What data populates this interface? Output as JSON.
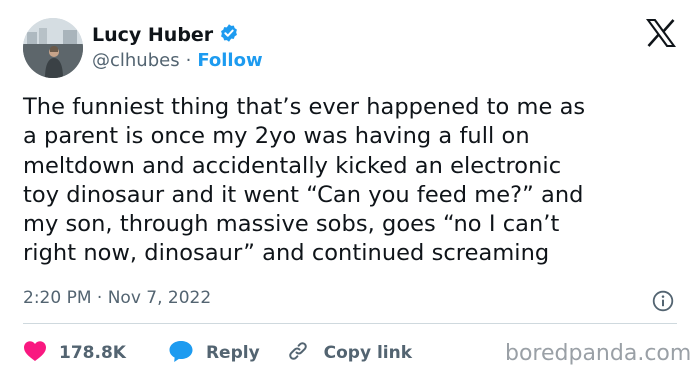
{
  "author": {
    "display_name": "Lucy Huber",
    "handle": "@clhubes",
    "separator": "·",
    "follow_label": "Follow",
    "verified_icon": "verified-badge-icon"
  },
  "platform_logo": "x-logo-icon",
  "tweet": {
    "lines": [
      "The funniest thing that’s ever happened to me as",
      "a parent is once my 2yo was having a full on",
      "meltdown and accidentally kicked an electronic",
      "toy dinosaur and it went “Can you feed me?” and",
      "my son, through massive sobs, goes “no I can’t",
      "right now, dinosaur” and continued screaming"
    ],
    "timestamp": "2:20 PM · Nov 7, 2022"
  },
  "actions": {
    "likes_count": "178.8K",
    "reply_label": "Reply",
    "copy_link_label": "Copy link"
  },
  "watermark": "boredpanda.com",
  "colors": {
    "accent": "#1d9bf0",
    "like": "#f91880",
    "text": "#0f1419",
    "secondary_text": "#536471"
  }
}
